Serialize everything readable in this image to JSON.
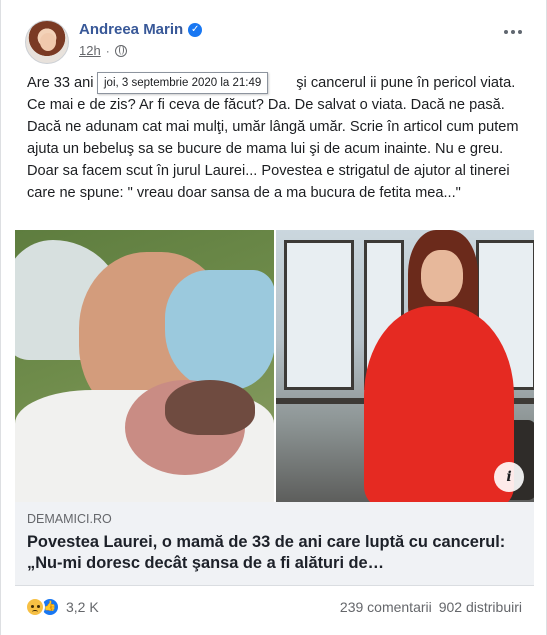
{
  "post": {
    "author": "Andreea Marin",
    "timestamp": "12h",
    "timestamp_tooltip": "joi, 3 septembrie 2020 la 21:49",
    "text": "Are 33 ani                                                  şi cancerul ii pune în pericol viata. Ce mai e de zis? Ar fi ceva de făcut? Da. De salvat o viata. Dacă ne pasă. Dacă ne adunam cat mai mulţi, umăr lângă umăr. Scrie în articol cum putem ajuta un bebeluş sa se bucure de mama lui şi de acum inainte. Nu e greu. Doar sa facem scut în jurul Laurei... Povestea e strigatul de ajutor al tinerei care ne spune: \" vreau doar sansa de a ma bucura de fetita mea...\""
  },
  "link_preview": {
    "domain": "DEMAMICI.RO",
    "title": "Povestea Laurei, o mamă de 33 de ani care luptă cu cancerul: „Nu-mi doresc decât şansa de a fi alături de…"
  },
  "footer": {
    "reactions_count": "3,2 K",
    "comments": "239 comentarii",
    "shares": "902 distribuiri"
  },
  "icons": {
    "verified": "verified-badge-icon",
    "audience": "globe-icon",
    "more": "more-options-icon",
    "info": "info-icon",
    "reaction_1": "sad-reaction-icon",
    "reaction_2": "like-reaction-icon"
  },
  "colors": {
    "author": "#385898",
    "verified": "#1877f2",
    "link_box_bg": "#f0f2f5",
    "secondary_text": "#65676b"
  }
}
